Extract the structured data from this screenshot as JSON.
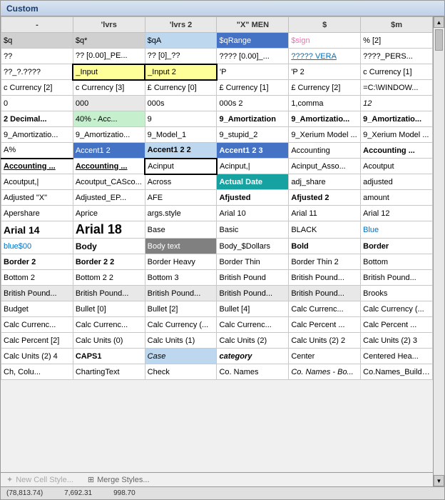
{
  "window": {
    "title": "Custom"
  },
  "grid": {
    "rows": [
      [
        {
          "text": "-",
          "class": "col-header"
        },
        {
          "text": "'lvrs",
          "class": "col-header"
        },
        {
          "text": "'lvrs 2",
          "class": "col-header"
        },
        {
          "text": "\"X\" MEN",
          "class": "col-header"
        },
        {
          "text": "$",
          "class": "col-header"
        },
        {
          "text": "$m",
          "class": "col-header"
        }
      ],
      [
        {
          "text": "$q",
          "class": "cell-gray"
        },
        {
          "text": "$q*",
          "class": "cell-gray"
        },
        {
          "text": "$qA",
          "class": "cell-light-blue"
        },
        {
          "text": "$qRange",
          "class": "cell-blue"
        },
        {
          "text": "$sign",
          "class": "text-pink"
        },
        {
          "text": "% [2]",
          "class": ""
        }
      ],
      [
        {
          "text": "??",
          "class": ""
        },
        {
          "text": "?? [0.00]_PE...",
          "class": ""
        },
        {
          "text": "?? [0]_??",
          "class": ""
        },
        {
          "text": "???? [0.00]_...",
          "class": ""
        },
        {
          "text": "????? VERA",
          "class": "text-blue text-underline"
        },
        {
          "text": "????_PERS...",
          "class": ""
        }
      ],
      [
        {
          "text": "??_?.????",
          "class": ""
        },
        {
          "text": "_Input",
          "class": "cell-yellow border-all"
        },
        {
          "text": "_Input 2",
          "class": "cell-yellow border-all"
        },
        {
          "text": "'P",
          "class": ""
        },
        {
          "text": "'P 2",
          "class": ""
        },
        {
          "text": "c Currency [1]",
          "class": ""
        }
      ],
      [
        {
          "text": "c Currency [2]",
          "class": ""
        },
        {
          "text": "c Currency [3]",
          "class": ""
        },
        {
          "text": "£ Currency [0]",
          "class": ""
        },
        {
          "text": "£ Currency [1]",
          "class": ""
        },
        {
          "text": "£ Currency [2]",
          "class": ""
        },
        {
          "text": "=C:\\WINDOW...",
          "class": ""
        }
      ],
      [
        {
          "text": "0",
          "class": ""
        },
        {
          "text": "000",
          "class": "cell-light-gray"
        },
        {
          "text": "000s",
          "class": ""
        },
        {
          "text": "000s 2",
          "class": ""
        },
        {
          "text": "1,comma",
          "class": ""
        },
        {
          "text": "12",
          "class": "text-italic"
        }
      ],
      [
        {
          "text": "2 Decimal...",
          "class": "text-bold"
        },
        {
          "text": "40% - Acc...",
          "class": "cell-green-bg"
        },
        {
          "text": "9",
          "class": ""
        },
        {
          "text": "9_Amortization",
          "class": "text-bold"
        },
        {
          "text": "9_Amortizatio...",
          "class": "text-bold"
        },
        {
          "text": "9_Amortizatio...",
          "class": "text-bold"
        }
      ],
      [
        {
          "text": "9_Amortizatio...",
          "class": ""
        },
        {
          "text": "9_Amortizatio...",
          "class": ""
        },
        {
          "text": "9_Model_1",
          "class": ""
        },
        {
          "text": "9_stupid_2",
          "class": ""
        },
        {
          "text": "9_Xerium Model ...",
          "class": ""
        },
        {
          "text": "9_Xerium Model ...",
          "class": ""
        }
      ],
      [
        {
          "text": "A%",
          "class": "border-bottom-cell"
        },
        {
          "text": "Accent1 2",
          "class": "cell-blue"
        },
        {
          "text": "Accent1 2 2",
          "class": "cell-light-blue text-bold"
        },
        {
          "text": "Accent1 2 3",
          "class": "cell-blue text-bold"
        },
        {
          "text": "Accounting",
          "class": ""
        },
        {
          "text": "Accounting ...",
          "class": "text-bold"
        }
      ],
      [
        {
          "text": "Accounting ...",
          "class": "text-bold text-underline"
        },
        {
          "text": "Accounting ...",
          "class": "text-bold text-underline"
        },
        {
          "text": "Acinput",
          "class": "border-all"
        },
        {
          "text": "Acinput,|",
          "class": ""
        },
        {
          "text": "Acinput_Asso...",
          "class": ""
        },
        {
          "text": "Acoutput",
          "class": ""
        }
      ],
      [
        {
          "text": "Acoutput,|",
          "class": ""
        },
        {
          "text": "Acoutput_CASco...",
          "class": ""
        },
        {
          "text": "Across",
          "class": ""
        },
        {
          "text": "Actual Date",
          "class": "cell-teal text-bold"
        },
        {
          "text": "adj_share",
          "class": ""
        },
        {
          "text": "adjusted",
          "class": ""
        }
      ],
      [
        {
          "text": "Adjusted \"X\"",
          "class": ""
        },
        {
          "text": "Adjusted_EP...",
          "class": ""
        },
        {
          "text": "AFE",
          "class": ""
        },
        {
          "text": "Afjusted",
          "class": "text-bold"
        },
        {
          "text": "Afjusted 2",
          "class": "text-bold"
        },
        {
          "text": "amount",
          "class": ""
        }
      ],
      [
        {
          "text": "Apershare",
          "class": ""
        },
        {
          "text": "Aprice",
          "class": ""
        },
        {
          "text": "args.style",
          "class": ""
        },
        {
          "text": "Arial 10",
          "class": ""
        },
        {
          "text": "Arial 11",
          "class": ""
        },
        {
          "text": "Arial 12",
          "class": ""
        }
      ],
      [
        {
          "text": "Arial 14",
          "class": "font-14"
        },
        {
          "text": "Arial 18",
          "class": "font-18"
        },
        {
          "text": "Base",
          "class": ""
        },
        {
          "text": "Basic",
          "class": ""
        },
        {
          "text": "BLACK",
          "class": ""
        },
        {
          "text": "Blue",
          "class": "text-blue"
        }
      ],
      [
        {
          "text": "blue$00",
          "class": "text-blue"
        },
        {
          "text": "Body",
          "class": "font-12b"
        },
        {
          "text": "Body text",
          "class": "cell-dark"
        },
        {
          "text": "Body_$Dollars",
          "class": ""
        },
        {
          "text": "Bold",
          "class": "text-bold"
        },
        {
          "text": "Border",
          "class": "text-bold"
        }
      ],
      [
        {
          "text": "Border 2",
          "class": "text-bold"
        },
        {
          "text": "Border 2 2",
          "class": "text-bold"
        },
        {
          "text": "Border Heavy",
          "class": ""
        },
        {
          "text": "Border Thin",
          "class": ""
        },
        {
          "text": "Border Thin 2",
          "class": ""
        },
        {
          "text": "Bottom",
          "class": ""
        }
      ],
      [
        {
          "text": "Bottom 2",
          "class": ""
        },
        {
          "text": "Bottom 2 2",
          "class": ""
        },
        {
          "text": "Bottom 3",
          "class": ""
        },
        {
          "text": "British Pound",
          "class": ""
        },
        {
          "text": "British Pound...",
          "class": ""
        },
        {
          "text": "British Pound...",
          "class": ""
        }
      ],
      [
        {
          "text": "British Pound...",
          "class": "cell-light-gray"
        },
        {
          "text": "British Pound...",
          "class": "cell-light-gray"
        },
        {
          "text": "British Pound...",
          "class": "cell-light-gray"
        },
        {
          "text": "British Pound...",
          "class": "cell-light-gray"
        },
        {
          "text": "British Pound...",
          "class": "cell-light-gray"
        },
        {
          "text": "Brooks",
          "class": ""
        }
      ],
      [
        {
          "text": "Budget",
          "class": ""
        },
        {
          "text": "Bullet [0]",
          "class": ""
        },
        {
          "text": "Bullet [2]",
          "class": ""
        },
        {
          "text": "Bullet [4]",
          "class": ""
        },
        {
          "text": "Calc Currenc...",
          "class": ""
        },
        {
          "text": "Calc Currency (...",
          "class": ""
        }
      ],
      [
        {
          "text": "Calc Currenc...",
          "class": ""
        },
        {
          "text": "Calc Currenc...",
          "class": ""
        },
        {
          "text": "Calc Currency (...",
          "class": ""
        },
        {
          "text": "Calc Currenc...",
          "class": ""
        },
        {
          "text": "Calc Percent ...",
          "class": ""
        },
        {
          "text": "Calc Percent ...",
          "class": ""
        }
      ],
      [
        {
          "text": "Calc Percent [2]",
          "class": ""
        },
        {
          "text": "Calc Units (0)",
          "class": ""
        },
        {
          "text": "Calc Units (1)",
          "class": ""
        },
        {
          "text": "Calc Units (2)",
          "class": ""
        },
        {
          "text": "Calc Units (2) 2",
          "class": ""
        },
        {
          "text": "Calc Units (2) 3",
          "class": ""
        }
      ],
      [
        {
          "text": "Calc Units (2) 4",
          "class": ""
        },
        {
          "text": "CAPS1",
          "class": "text-bold"
        },
        {
          "text": "Case",
          "class": "cell-light-blue text-italic"
        },
        {
          "text": "category",
          "class": "text-bold text-italic"
        },
        {
          "text": "Center",
          "class": ""
        },
        {
          "text": "Centered Hea...",
          "class": ""
        }
      ],
      [
        {
          "text": "Ch, Colu...",
          "class": ""
        },
        {
          "text": "ChartingText",
          "class": ""
        },
        {
          "text": "Check",
          "class": ""
        },
        {
          "text": "Co. Names",
          "class": ""
        },
        {
          "text": "Co. Names - Bo...",
          "class": "text-italic"
        },
        {
          "text": "Co.Names_Buildup...",
          "class": ""
        }
      ]
    ]
  },
  "bottom_buttons": [
    {
      "label": "New Cell Style...",
      "disabled": true
    },
    {
      "label": "Merge Styles...",
      "disabled": false
    }
  ],
  "footer": {
    "values": [
      "(78,813.74)",
      "7,692.31",
      "998.70"
    ]
  },
  "scrollbar": {
    "up_arrow": "▲",
    "down_arrow": "▼"
  }
}
